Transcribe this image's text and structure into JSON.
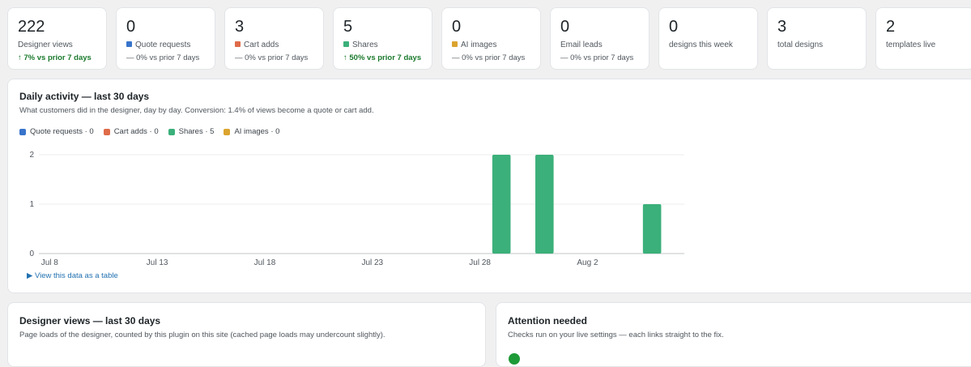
{
  "stats": [
    {
      "value": "222",
      "label": "Designer views",
      "delta": "↑ 7% vs prior 7 days",
      "trend": "up",
      "color": ""
    },
    {
      "value": "0",
      "label": "Quote requests",
      "delta": "— 0% vs prior 7 days",
      "trend": "flat",
      "color": "#3874cb"
    },
    {
      "value": "3",
      "label": "Cart adds",
      "delta": "— 0% vs prior 7 days",
      "trend": "flat",
      "color": "#df6b49"
    },
    {
      "value": "5",
      "label": "Shares",
      "delta": "↑ 50% vs prior 7 days",
      "trend": "up",
      "color": "#3bb07a"
    },
    {
      "value": "0",
      "label": "AI images",
      "delta": "— 0% vs prior 7 days",
      "trend": "flat",
      "color": "#dba42f"
    },
    {
      "value": "0",
      "label": "Email leads",
      "delta": "— 0% vs prior 7 days",
      "trend": "flat",
      "color": ""
    },
    {
      "value": "0",
      "label": "designs this week",
      "delta": "",
      "trend": "none",
      "color": ""
    },
    {
      "value": "3",
      "label": "total designs",
      "delta": "",
      "trend": "none",
      "color": ""
    },
    {
      "value": "2",
      "label": "templates live",
      "delta": "",
      "trend": "none",
      "color": ""
    }
  ],
  "activity": {
    "title": "Daily activity — last 30 days",
    "subtitle": "What customers did in the designer, day by day. Conversion: 1.4% of views become a quote or cart add.",
    "legend": [
      {
        "label": "Quote requests · 0",
        "color": "#3874cb"
      },
      {
        "label": "Cart adds · 0",
        "color": "#df6b49"
      },
      {
        "label": "Shares · 5",
        "color": "#3bb07a"
      },
      {
        "label": "AI images · 0",
        "color": "#dba42f"
      }
    ],
    "table_link": "▶ View this data as a table"
  },
  "chart_data": {
    "type": "bar",
    "categories": [
      "Jul 8",
      "Jul 9",
      "Jul 10",
      "Jul 11",
      "Jul 12",
      "Jul 13",
      "Jul 14",
      "Jul 15",
      "Jul 16",
      "Jul 17",
      "Jul 18",
      "Jul 19",
      "Jul 20",
      "Jul 21",
      "Jul 22",
      "Jul 23",
      "Jul 24",
      "Jul 25",
      "Jul 26",
      "Jul 27",
      "Jul 28",
      "Jul 29",
      "Jul 30",
      "Jul 31",
      "Aug 1",
      "Aug 2",
      "Aug 3",
      "Aug 4",
      "Aug 5",
      "Aug 6"
    ],
    "tick_labels": [
      "Jul 8",
      "Jul 13",
      "Jul 18",
      "Jul 23",
      "Jul 28",
      "Aug 2"
    ],
    "series": [
      {
        "name": "Quote requests",
        "color": "#3874cb",
        "values": [
          0,
          0,
          0,
          0,
          0,
          0,
          0,
          0,
          0,
          0,
          0,
          0,
          0,
          0,
          0,
          0,
          0,
          0,
          0,
          0,
          0,
          0,
          0,
          0,
          0,
          0,
          0,
          0,
          0,
          0
        ]
      },
      {
        "name": "Cart adds",
        "color": "#df6b49",
        "values": [
          0,
          0,
          0,
          0,
          0,
          0,
          0,
          0,
          0,
          0,
          0,
          0,
          0,
          0,
          0,
          0,
          0,
          0,
          0,
          0,
          0,
          0,
          0,
          0,
          0,
          0,
          0,
          0,
          0,
          0
        ]
      },
      {
        "name": "Shares",
        "color": "#3bb07a",
        "values": [
          0,
          0,
          0,
          0,
          0,
          0,
          0,
          0,
          0,
          0,
          0,
          0,
          0,
          0,
          0,
          0,
          0,
          0,
          0,
          0,
          0,
          2,
          0,
          2,
          0,
          0,
          0,
          0,
          1,
          0
        ]
      },
      {
        "name": "AI images",
        "color": "#dba42f",
        "values": [
          0,
          0,
          0,
          0,
          0,
          0,
          0,
          0,
          0,
          0,
          0,
          0,
          0,
          0,
          0,
          0,
          0,
          0,
          0,
          0,
          0,
          0,
          0,
          0,
          0,
          0,
          0,
          0,
          0,
          0
        ]
      }
    ],
    "yticks": [
      0,
      1,
      2
    ],
    "ylim": [
      0,
      2
    ],
    "grid": true,
    "stacked": true
  },
  "views_panel": {
    "title": "Designer views — last 30 days",
    "subtitle": "Page loads of the designer, counted by this plugin on this site (cached page loads may undercount slightly)."
  },
  "attention_panel": {
    "title": "Attention needed",
    "subtitle": "Checks run on your live settings — each links straight to the fix."
  }
}
